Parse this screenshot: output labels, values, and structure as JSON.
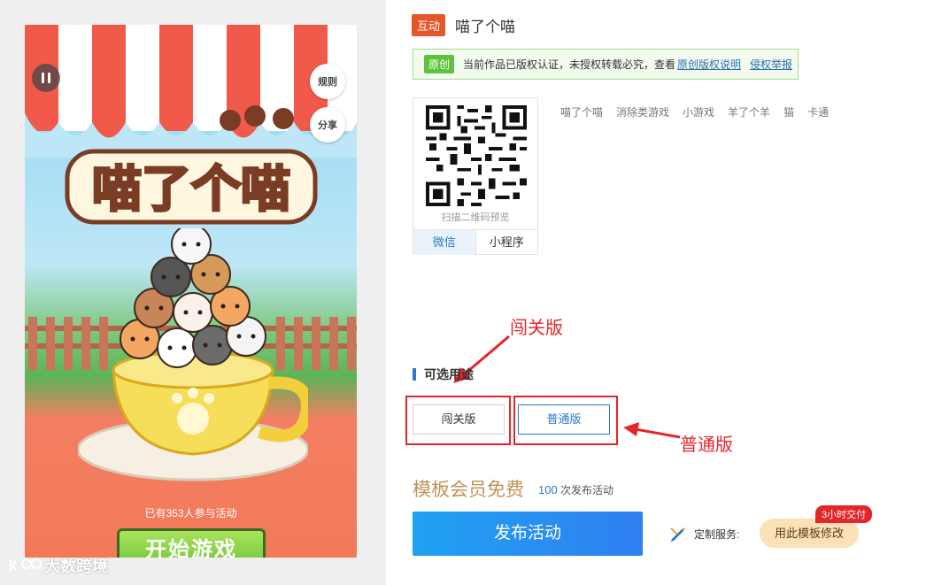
{
  "preview": {
    "game_title": "喵了个喵",
    "rules_label": "规则",
    "share_label": "分享",
    "participants_text": "已有353人参与活动",
    "start_button": "开始游戏"
  },
  "watermark": {
    "text": "大数跨境"
  },
  "product": {
    "badge": "互动",
    "title": "喵了个喵"
  },
  "notice": {
    "tag": "原创",
    "text": "当前作品已版权认证，未授权转载必究，查看",
    "link_copyright": "原创版权说明",
    "link_report": "侵权举报"
  },
  "qr": {
    "scan_text": "扫描二维码预览",
    "tabs": [
      "微信",
      "小程序"
    ],
    "active_tab": "微信"
  },
  "tags": [
    "喵了个喵",
    "消除类游戏",
    "小游戏",
    "羊了个羊",
    "猫",
    "卡通"
  ],
  "versions": {
    "section_title": "可选用途",
    "options": [
      "闯关版",
      "普通版"
    ],
    "selected": "普通版"
  },
  "annotations": {
    "level_label": "闯关版",
    "normal_label": "普通版"
  },
  "pricing": {
    "member_free": "模板会员免费",
    "publish_count": "100",
    "publish_count_suffix": "次发布活动"
  },
  "actions": {
    "publish": "发布活动",
    "custom_service_label": "定制服务:",
    "modify_button": "用此模板修改",
    "delivery_badge": "3小时交付"
  },
  "colors": {
    "accent_blue": "#2a7ac8",
    "badge_orange": "#e5562a",
    "annotation_red": "#e3262a",
    "original_green": "#5dc33b",
    "gold_text": "#c2935a"
  }
}
